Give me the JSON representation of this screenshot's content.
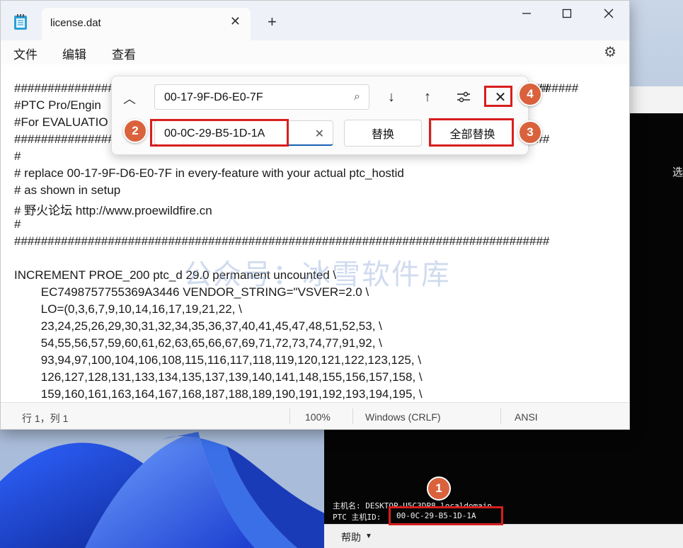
{
  "notepad": {
    "tab_title": "license.dat",
    "new_tab": "+",
    "menu": [
      "文件",
      "编辑",
      "查看"
    ],
    "lines": [
      "################################################################################",
      "#PTC Pro/Engin",
      "#For EVALUATIO",
      "################################################################################",
      "#",
      "# replace 00-17-9F-D6-E0-7F in every-feature with your actual ptc_hostid",
      "# as shown in setup",
      "# 野火论坛 http://www.proewildfire.cn",
      "#",
      "################################################################################",
      "",
      "INCREMENT PROE_200 ptc_d 29.0 permanent uncounted \\",
      "        EC7498757755369A3446 VENDOR_STRING=\"VSVER=2.0 \\",
      "        LO=(0,3,6,7,9,10,14,16,17,19,21,22, \\",
      "        23,24,25,26,29,30,31,32,34,35,36,37,40,41,45,47,48,51,52,53, \\",
      "        54,55,56,57,59,60,61,62,63,65,66,67,69,71,72,73,74,77,91,92, \\",
      "        93,94,97,100,104,106,108,115,116,117,118,119,120,121,122,123,125, \\",
      "        126,127,128,131,133,134,135,137,139,140,141,148,155,156,157,158, \\",
      "        159,160,161,163,164,167,168,187,188,189,190,191,192,193,194,195, \\"
    ],
    "line_tail_hash": "#######",
    "status": {
      "position": "行 1，列 1",
      "zoom": "100%",
      "line_ending": "Windows (CRLF)",
      "encoding": "ANSI"
    }
  },
  "find_replace": {
    "find_value": "00-17-9F-D6-E0-7F",
    "replace_value": "00-0C-29-B5-1D-1A",
    "replace_label": "替换",
    "replace_all_label": "全部替换"
  },
  "watermark": "公众号：冰雪软件库",
  "setup_window": {
    "side_text": "选",
    "hostname_label": "主机名: DESKTOP-U5C3DP8.localdomain",
    "hostid_label": "PTC 主机ID:",
    "hostid_value": "00-0C-29-B5-1D-1A",
    "help_label": "帮助"
  },
  "annotations": [
    "1",
    "2",
    "3",
    "4"
  ],
  "colors": {
    "annotation_red": "#d81e1e",
    "badge_orange": "#d9623d",
    "accent_blue": "#1a5fb4"
  }
}
